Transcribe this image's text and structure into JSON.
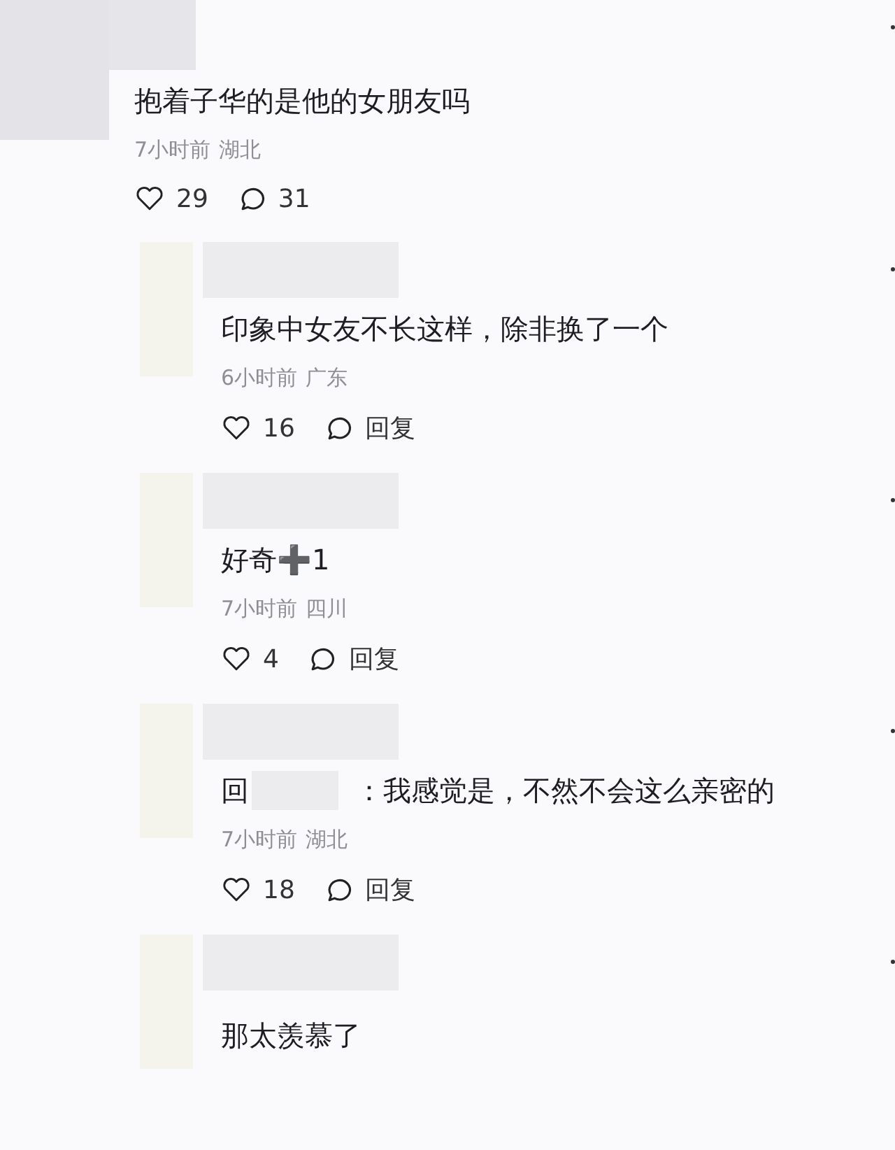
{
  "comments": [
    {
      "kind": "top",
      "text": "抱着子华的是他的女朋友吗",
      "time": "7小时前",
      "location": "湖北",
      "likes": "29",
      "reply_label": "31"
    },
    {
      "kind": "reply",
      "text": "印象中女友不长这样，除非换了一个",
      "time": "6小时前",
      "location": "广东",
      "likes": "16",
      "reply_label": "回复"
    },
    {
      "kind": "reply",
      "text": "好奇➕1",
      "time": "7小时前",
      "location": "四川",
      "likes": "4",
      "reply_label": "回复"
    },
    {
      "kind": "reply",
      "prefix": "回",
      "text": "：我感觉是，不然不会这么亲密的",
      "time": "7小时前",
      "location": "湖北",
      "likes": "18",
      "reply_label": "回复"
    },
    {
      "kind": "reply",
      "text": "那太羡慕了"
    }
  ]
}
